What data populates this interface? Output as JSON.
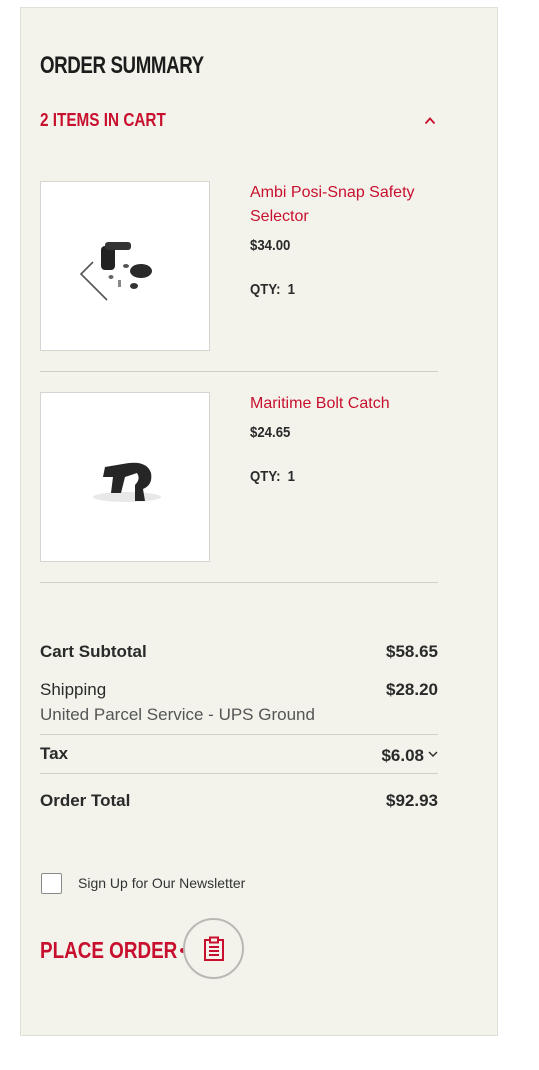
{
  "summary": {
    "title": "ORDER SUMMARY",
    "cart_toggle_label": "2 ITEMS IN CART"
  },
  "items": [
    {
      "name": "Ambi Posi-Snap Safety Selector",
      "price": "$34.00",
      "qty_label": "QTY:",
      "qty": "1",
      "image_icon": "safety-selector-parts"
    },
    {
      "name": "Maritime Bolt Catch",
      "price": "$24.65",
      "qty_label": "QTY:",
      "qty": "1",
      "image_icon": "bolt-catch"
    }
  ],
  "totals": {
    "subtotal_label": "Cart Subtotal",
    "subtotal_value": "$58.65",
    "shipping_label": "Shipping",
    "shipping_method": "United Parcel Service - UPS Ground",
    "shipping_value": "$28.20",
    "tax_label": "Tax",
    "tax_value": "$6.08",
    "total_label": "Order Total",
    "total_value": "$92.93"
  },
  "newsletter": {
    "label": "Sign Up for Our Newsletter",
    "checked": false
  },
  "place_order": {
    "label": "PLACE ORDER"
  },
  "colors": {
    "accent": "#c8102e",
    "panel_background": "#f3f3ec",
    "text": "#2a2a2a"
  }
}
